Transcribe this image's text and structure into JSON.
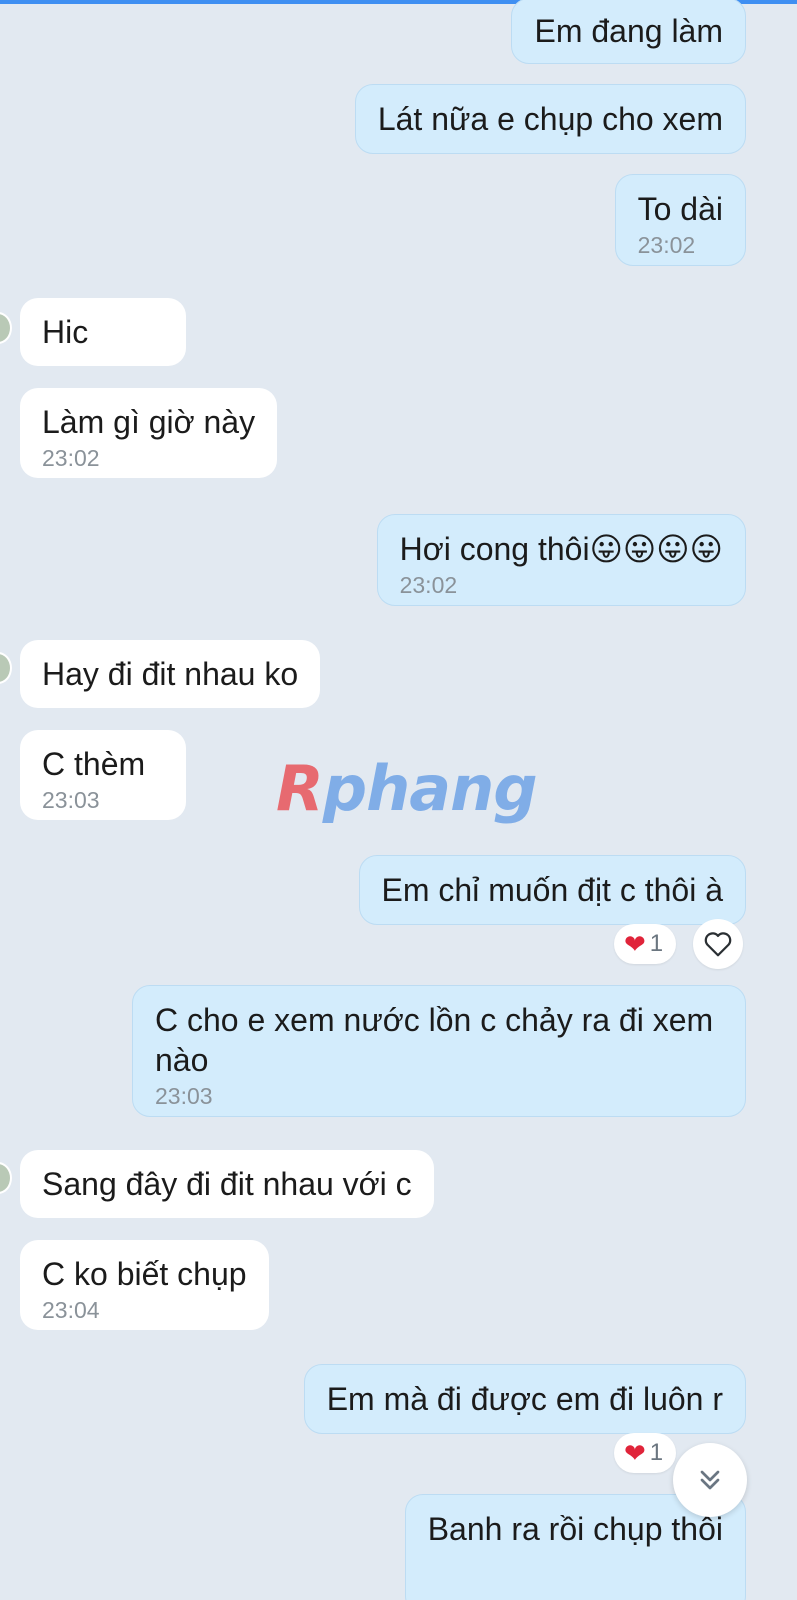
{
  "messages": [
    {
      "text": "Em đang làm",
      "time": ""
    },
    {
      "text": "Lát nữa e chụp cho xem",
      "time": ""
    },
    {
      "text": "To dài",
      "time": "23:02"
    },
    {
      "text": "Hic",
      "time": ""
    },
    {
      "text": "Làm gì giờ này",
      "time": "23:02"
    },
    {
      "text": "Hơi cong thôi😛😛😛😛",
      "time": "23:02"
    },
    {
      "text": "Hay đi đit nhau ko",
      "time": ""
    },
    {
      "text": "C thèm",
      "time": "23:03"
    },
    {
      "text": "Em chỉ muốn địt c thôi à",
      "time": ""
    },
    {
      "text": "C cho e xem nước lồn c chảy ra đi xem nào",
      "time": "23:03"
    },
    {
      "text": "Sang đây đi đit nhau với c",
      "time": ""
    },
    {
      "text": "C ko biết chụp",
      "time": "23:04"
    },
    {
      "text": "Em mà đi được em đi luôn r",
      "time": ""
    },
    {
      "text": "Banh ra rồi chụp thôi",
      "time": ""
    }
  ],
  "reactions": [
    {
      "emoji": "❤",
      "count": "1"
    },
    {
      "emoji": "❤",
      "count": "1"
    }
  ],
  "watermark": {
    "first": "R",
    "rest": "phang"
  },
  "colors": {
    "background": "#e2e9f1",
    "incoming_bubble": "#ffffff",
    "outgoing_bubble": "#d3ecfc",
    "heart": "#e0243a",
    "top_bar": "#3f8ff2"
  },
  "icons": {
    "react_button": "heart-outline-icon",
    "scroll_down": "double-chevron-down-icon"
  }
}
